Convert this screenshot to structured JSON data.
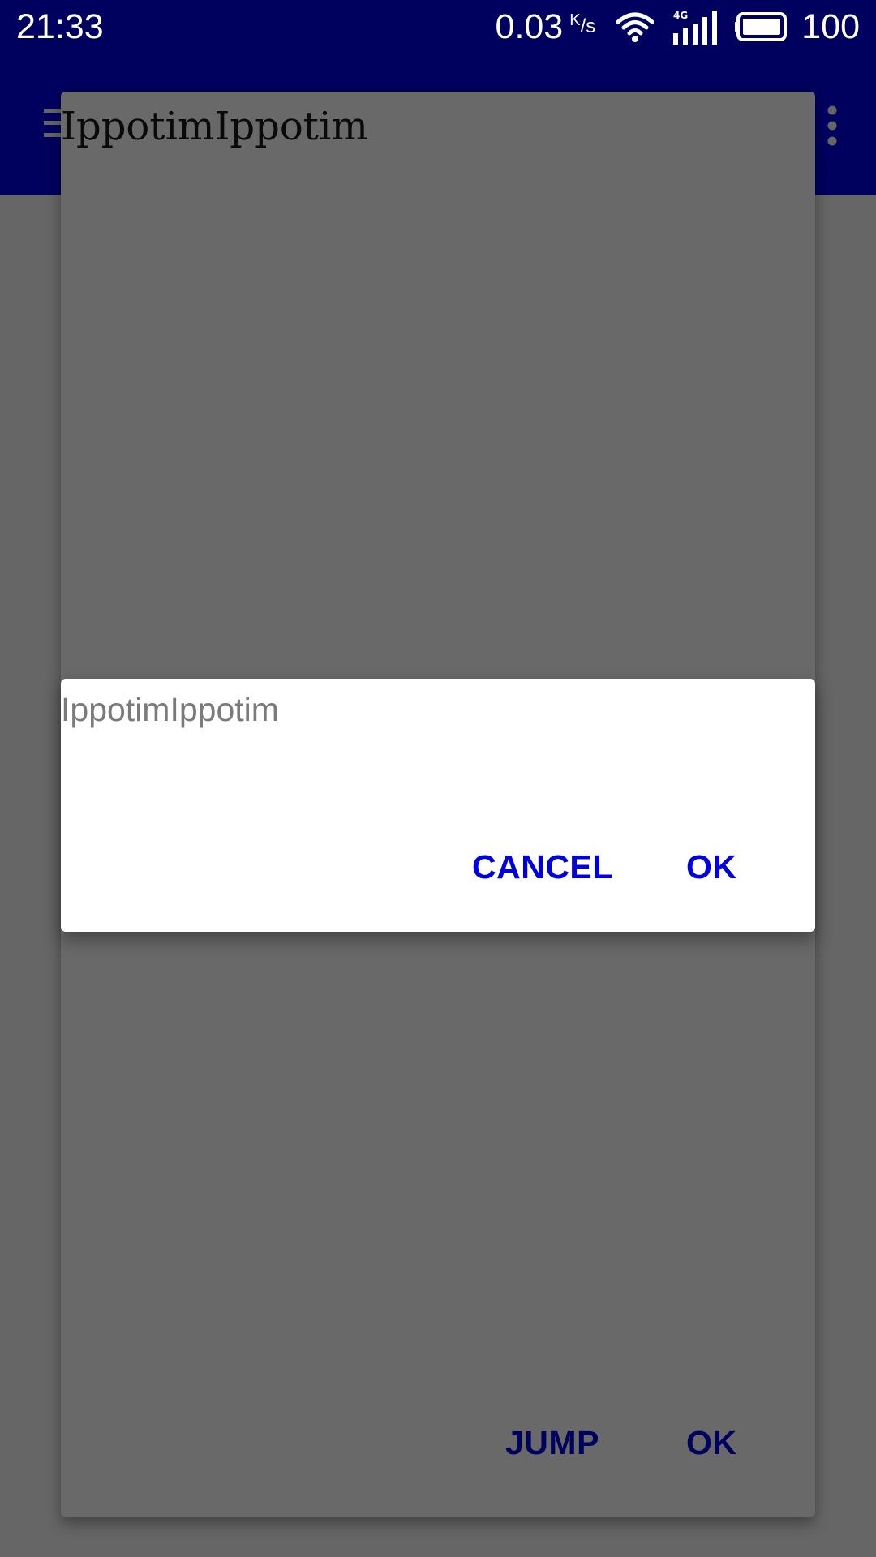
{
  "status_bar": {
    "time": "21:33",
    "speed_value": "0.03",
    "speed_unit_k": "K",
    "speed_unit_s": "/s",
    "network_type": "4G",
    "battery": "100",
    "icons": [
      "wifi-icon",
      "signal-icon",
      "battery-icon"
    ]
  },
  "app_bar": {
    "icons": [
      "menu-icon",
      "overflow-menu-icon"
    ]
  },
  "background_dialog": {
    "title": "IppotimIppotim",
    "buttons": {
      "jump": "JUMP",
      "ok": "OK"
    }
  },
  "front_dialog": {
    "input_value": "IppotimIppotim",
    "buttons": {
      "cancel": "CANCEL",
      "ok": "OK"
    }
  },
  "colors": {
    "status_bar_bg": "#00005f",
    "scrim_bg": "#666666",
    "front_button_text": "#0000dd",
    "background_button_text": "#00005f"
  }
}
